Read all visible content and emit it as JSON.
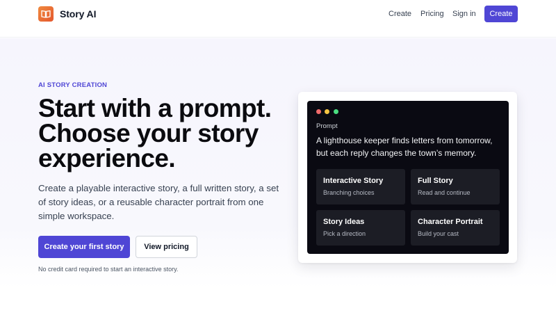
{
  "header": {
    "logo_text": "Story AI",
    "logo_icon": "book-icon",
    "nav": {
      "create": "Create",
      "pricing": "Pricing",
      "sign_in": "Sign in"
    },
    "cta": "Create"
  },
  "hero": {
    "eyebrow": "AI STORY CREATION",
    "headline": "Start with a prompt. Choose your story experience.",
    "subtext": "Create a playable interactive story, a full written story, a set of story ideas, or a reusable character portrait from one simple workspace.",
    "primary_button": "Create your first story",
    "secondary_button": "View pricing",
    "note": "No credit card required to start an interactive story."
  },
  "preview": {
    "prompt_label": "Prompt",
    "prompt_text": "A lighthouse keeper finds letters from tomorrow, but each reply changes the town’s memory.",
    "options": [
      {
        "title": "Interactive Story",
        "desc": "Branching choices"
      },
      {
        "title": "Full Story",
        "desc": "Read and continue"
      },
      {
        "title": "Story Ideas",
        "desc": "Pick a direction"
      },
      {
        "title": "Character Portrait",
        "desc": "Build your cast"
      }
    ]
  },
  "colors": {
    "accent": "#4f46d5",
    "logo_gradient_start": "#f08a3e",
    "logo_gradient_end": "#e4572e",
    "dot_red": "#ef6b6b",
    "dot_yellow": "#f5c542",
    "dot_green": "#4ade80"
  }
}
